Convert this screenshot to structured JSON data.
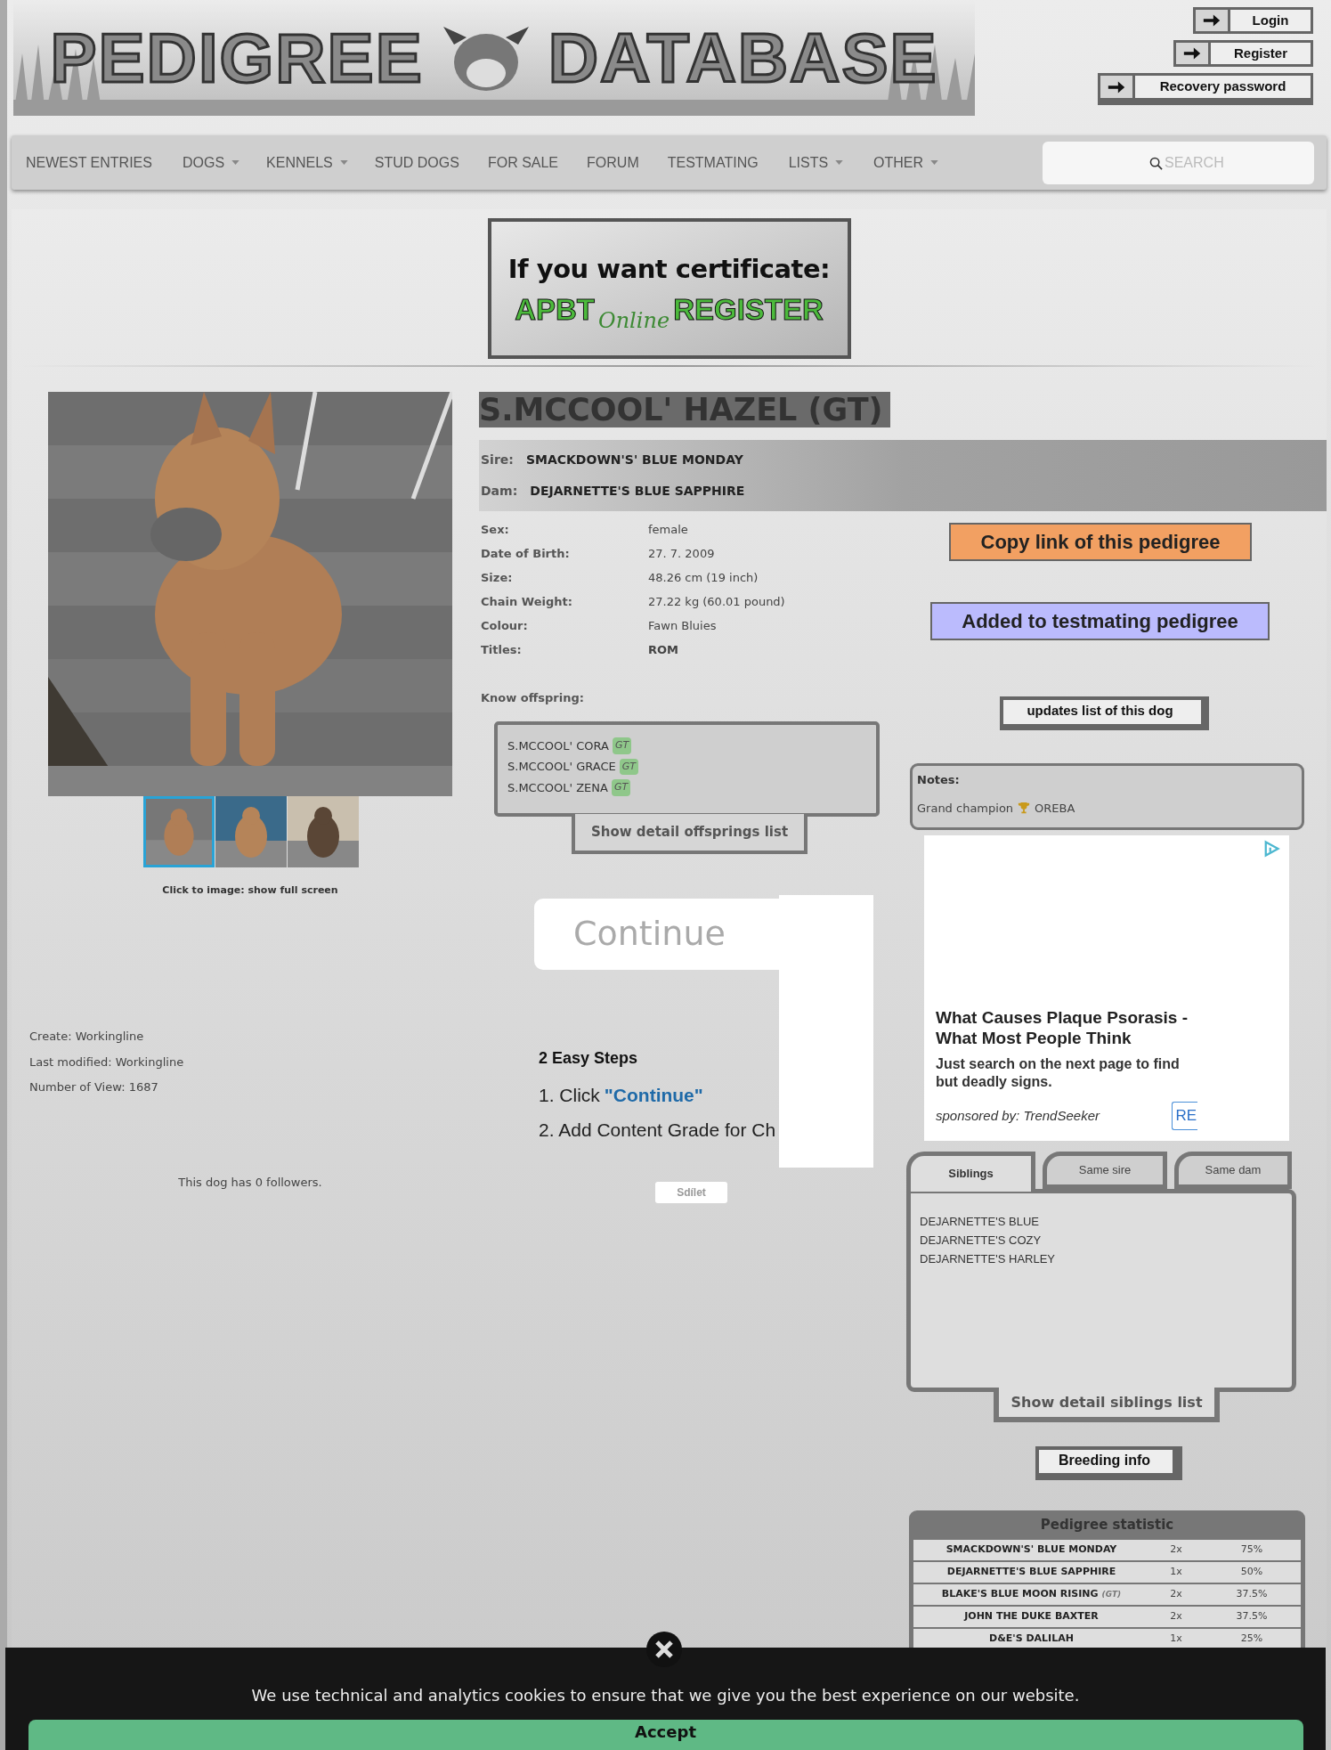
{
  "header": {
    "logo_words": [
      "PEDIGREE",
      "DATABASE"
    ],
    "account_links": [
      "Login",
      "Register",
      "Recovery password"
    ]
  },
  "nav": {
    "items": [
      {
        "label": "NEWEST ENTRIES",
        "has_menu": false
      },
      {
        "label": "DOGS",
        "has_menu": true
      },
      {
        "label": "KENNELS",
        "has_menu": true
      },
      {
        "label": "STUD DOGS",
        "has_menu": false
      },
      {
        "label": "FOR SALE",
        "has_menu": false
      },
      {
        "label": "FORUM",
        "has_menu": false
      },
      {
        "label": "TESTMATING",
        "has_menu": false
      },
      {
        "label": "LISTS",
        "has_menu": true
      },
      {
        "label": "OTHER",
        "has_menu": true
      }
    ],
    "search": {
      "placeholder": "SEARCH"
    }
  },
  "banner": {
    "headline": "If you want certificate:",
    "words": [
      "APBT",
      "Online",
      "REGISTER"
    ]
  },
  "gallery": {
    "thumbnails": [
      {
        "selected": true
      },
      {
        "selected": false
      },
      {
        "selected": false
      }
    ],
    "caption": "Click to image: show full screen"
  },
  "record": {
    "lines": [
      "Create: Workingline",
      "Last modified: Workingline",
      "Number of View: 1687"
    ],
    "followers": "This dog has 0 followers."
  },
  "dog": {
    "name": "S.MCCOOL' HAZEL (GT)",
    "parents": [
      {
        "label": "Sire:",
        "name": "SMACKDOWN'S' BLUE MONDAY"
      },
      {
        "label": "Dam:",
        "name": "DEJARNETTE'S BLUE SAPPHIRE"
      }
    ],
    "details": [
      {
        "label": "Sex:",
        "value": "female",
        "bold": false
      },
      {
        "label": "Date of Birth:",
        "value": "27. 7. 2009",
        "bold": false
      },
      {
        "label": "Size:",
        "value": "48.26 cm (19 inch)",
        "bold": false
      },
      {
        "label": "Chain Weight:",
        "value": "27.22 kg (60.01 pound)",
        "bold": false
      },
      {
        "label": "Colour:",
        "value": "Fawn Bluies",
        "bold": false
      },
      {
        "label": "Titles:",
        "value": "ROM",
        "bold": true
      }
    ]
  },
  "offspring": {
    "heading": "Know offspring:",
    "items": [
      {
        "name": "S.MCCOOL' CORA",
        "badge": "GT"
      },
      {
        "name": "S.MCCOOL' GRACE",
        "badge": "GT"
      },
      {
        "name": "S.MCCOOL' ZENA",
        "badge": "GT"
      }
    ],
    "button": "Show detail offsprings list"
  },
  "actions": {
    "copy_link": "Copy link of this pedigree",
    "testmating": "Added to testmating pedigree",
    "updates": "updates list of this dog"
  },
  "notes": {
    "heading": "Notes:",
    "text_before": "Grand champion",
    "text_after": "OREBA"
  },
  "ad_middle": {
    "button": "Continue",
    "heading": "2 Easy Steps",
    "step_one": "1. Click",
    "step_one_link": "\"Continue\"",
    "step_two": "2. Add Content Grade for Ch"
  },
  "share_button": "Sdílet",
  "ad_right": {
    "headline_lines": [
      "What Causes Plaque Psorasis -",
      "What Most People Think"
    ],
    "body_lines": [
      "Just search on the next page to find",
      "but deadly signs."
    ],
    "sponsor": "sponsored by: TrendSeeker",
    "button": "RE"
  },
  "siblings": {
    "tabs": [
      {
        "label": "Siblings",
        "selected": true
      },
      {
        "label": "Same sire",
        "selected": false
      },
      {
        "label": "Same dam",
        "selected": false
      }
    ],
    "items": [
      "DEJARNETTE'S BLUE",
      "DEJARNETTE'S COZY",
      "DEJARNETTE'S HARLEY"
    ],
    "button": "Show detail siblings list"
  },
  "breeding_button": "Breeding info",
  "statistic": {
    "title": "Pedigree statistic",
    "rows": [
      {
        "name": "SMACKDOWN'S' BLUE MONDAY",
        "count": "2x",
        "share": "75%"
      },
      {
        "name": "DEJARNETTE'S BLUE SAPPHIRE",
        "count": "1x",
        "share": "50%"
      },
      {
        "name": "BLAKE'S BLUE MOON RISING",
        "badge": "(GT)",
        "count": "2x",
        "share": "37.5%"
      },
      {
        "name": "JOHN THE DUKE BAXTER",
        "count": "2x",
        "share": "37.5%"
      },
      {
        "name": "D&E'S DALILAH",
        "count": "1x",
        "share": "25%"
      }
    ]
  },
  "cookie": {
    "message": "We use technical and analytics cookies to ensure that we give you the best experience on our website.",
    "accept": "Accept"
  }
}
